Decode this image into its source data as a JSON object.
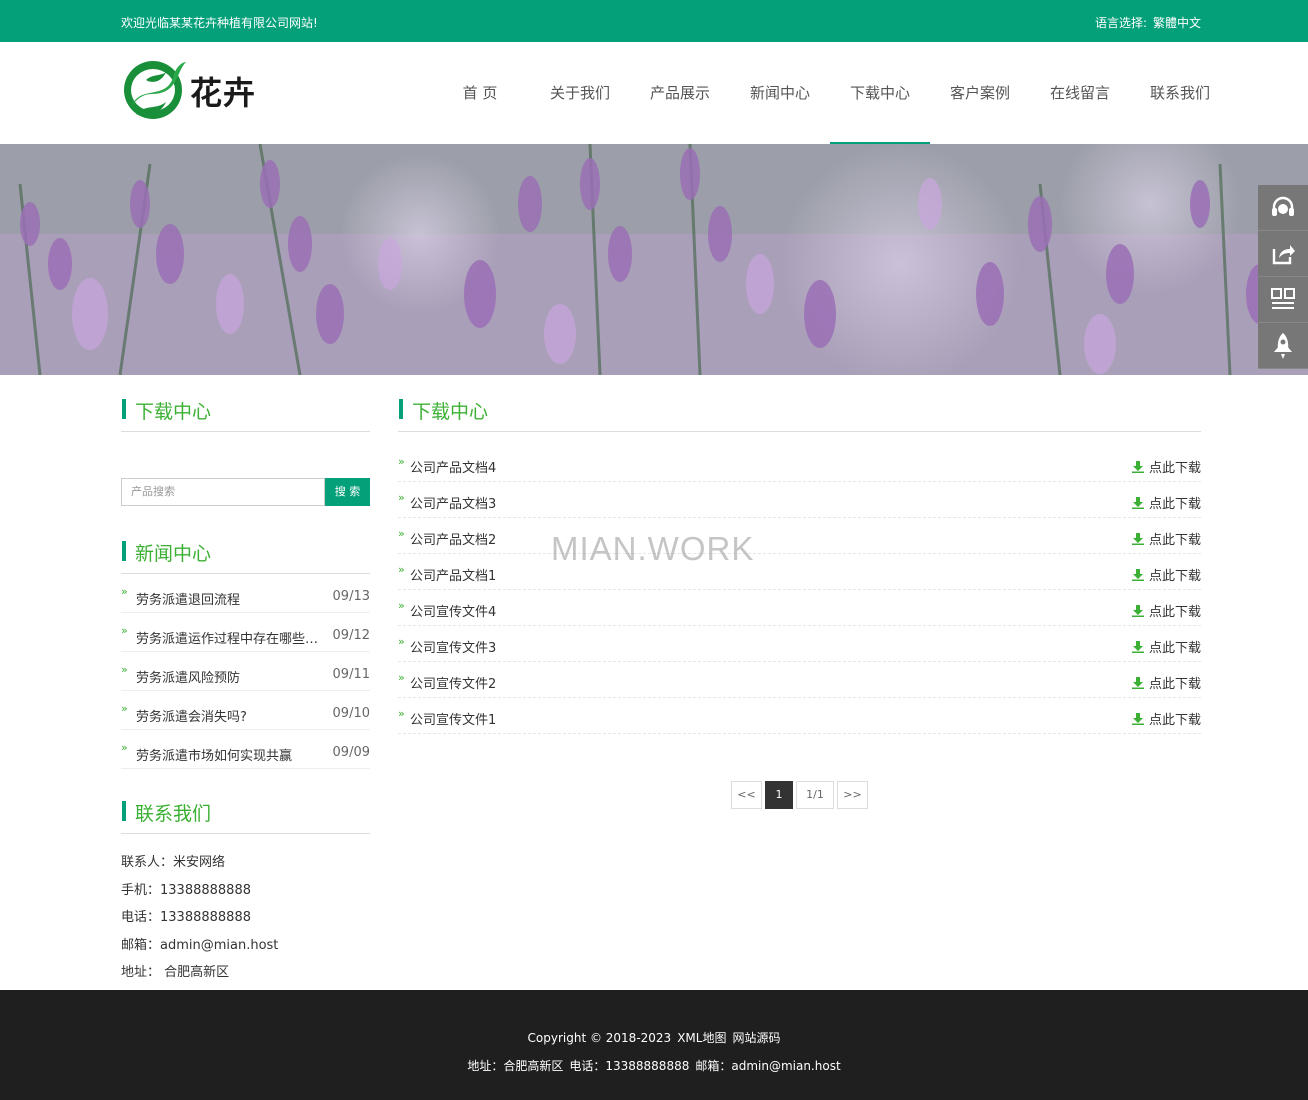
{
  "topbar": {
    "welcome": "欢迎光临某某花卉种植有限公司网站!",
    "lang_label": "语言选择:",
    "lang_option": "繁體中文"
  },
  "logo": {
    "text": "花卉"
  },
  "nav": {
    "items": [
      {
        "label": "首 页"
      },
      {
        "label": "关于我们"
      },
      {
        "label": "产品展示"
      },
      {
        "label": "新闻中心"
      },
      {
        "label": "下载中心",
        "active": true
      },
      {
        "label": "客户案例"
      },
      {
        "label": "在线留言"
      },
      {
        "label": "联系我们"
      }
    ]
  },
  "side_tools": [
    "headset-icon",
    "share-icon",
    "qrcode-icon",
    "rocket-icon"
  ],
  "sidebar": {
    "download_title": "下载中心",
    "search": {
      "placeholder": "产品搜索",
      "button": "搜 索"
    },
    "news_title": "新闻中心",
    "news": [
      {
        "title": "劳务派遣退回流程",
        "date": "09/13"
      },
      {
        "title": "劳务派遣运作过程中存在哪些问题",
        "date": "09/12"
      },
      {
        "title": "劳务派遣风险预防",
        "date": "09/11"
      },
      {
        "title": "劳务派遣会消失吗?",
        "date": "09/10"
      },
      {
        "title": "劳务派遣市场如何实现共赢",
        "date": "09/09"
      }
    ],
    "contact_title": "联系我们",
    "contact": [
      "联系人：米安网络",
      "手机：13388888888",
      "电话：13388888888",
      "邮箱：admin@mian.host",
      "地址： 合肥高新区"
    ]
  },
  "content": {
    "title": "下载中心",
    "download_label": "点此下载",
    "files": [
      "公司产品文档4",
      "公司产品文档3",
      "公司产品文档2",
      "公司产品文档1",
      "公司宣传文件4",
      "公司宣传文件3",
      "公司宣传文件2",
      "公司宣传文件1"
    ],
    "pager": {
      "prev": "<<",
      "current": "1",
      "total": "1/1",
      "next": ">>"
    }
  },
  "watermark": "MIAN.WORK",
  "footer": {
    "copyright": "Copyright © 2018-2023",
    "xml": "XML地图",
    "source": "网站源码",
    "address": "地址：合肥高新区",
    "phone": "电话：13388888888",
    "email": "邮箱：admin@mian.host"
  },
  "colors": {
    "accent": "#04a07a",
    "title_green": "#3cb034",
    "footer_bg": "#1f1f1f"
  }
}
